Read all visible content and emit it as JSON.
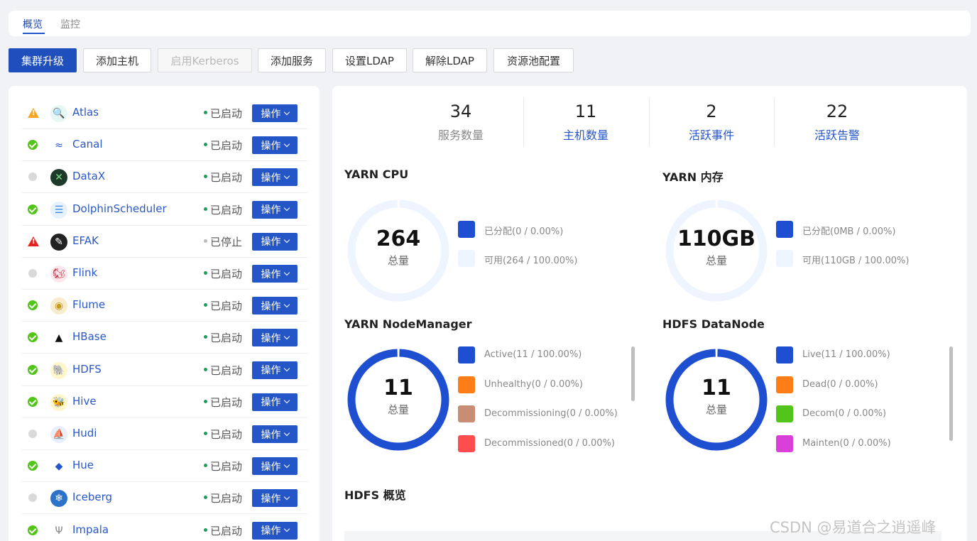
{
  "tabs": [
    {
      "label": "概览",
      "active": true
    },
    {
      "label": "监控",
      "active": false
    }
  ],
  "toolbar": {
    "upgrade": "集群升级",
    "add_host": "添加主机",
    "enable_kerberos": "启用Kerberos",
    "add_service": "添加服务",
    "set_ldap": "设置LDAP",
    "remove_ldap": "解除LDAP",
    "resource_pool": "资源池配置"
  },
  "operate_label": "操作",
  "services": [
    {
      "name": "Atlas",
      "health": "warning",
      "state": "已启动",
      "logo": "atlas-icon"
    },
    {
      "name": "Canal",
      "health": "ok",
      "state": "已启动",
      "logo": "canal-icon"
    },
    {
      "name": "DataX",
      "health": "unknown",
      "state": "已启动",
      "logo": "datax-icon"
    },
    {
      "name": "DolphinScheduler",
      "health": "ok",
      "state": "已启动",
      "logo": "dolphinscheduler-icon"
    },
    {
      "name": "EFAK",
      "health": "error",
      "state": "已停止",
      "logo": "efak-icon"
    },
    {
      "name": "Flink",
      "health": "unknown",
      "state": "已启动",
      "logo": "flink-icon"
    },
    {
      "name": "Flume",
      "health": "ok",
      "state": "已启动",
      "logo": "flume-icon"
    },
    {
      "name": "HBase",
      "health": "ok",
      "state": "已启动",
      "logo": "hbase-icon"
    },
    {
      "name": "HDFS",
      "health": "ok",
      "state": "已启动",
      "logo": "hdfs-icon"
    },
    {
      "name": "Hive",
      "health": "ok",
      "state": "已启动",
      "logo": "hive-icon"
    },
    {
      "name": "Hudi",
      "health": "unknown",
      "state": "已启动",
      "logo": "hudi-icon"
    },
    {
      "name": "Hue",
      "health": "ok",
      "state": "已启动",
      "logo": "hue-icon"
    },
    {
      "name": "Iceberg",
      "health": "unknown",
      "state": "已启动",
      "logo": "iceberg-icon"
    },
    {
      "name": "Impala",
      "health": "ok",
      "state": "已启动",
      "logo": "impala-icon"
    }
  ],
  "stats": [
    {
      "value": "34",
      "label": "服务数量",
      "link": false
    },
    {
      "value": "11",
      "label": "主机数量",
      "link": true
    },
    {
      "value": "2",
      "label": "活跃事件",
      "link": true
    },
    {
      "value": "22",
      "label": "活跃告警",
      "link": true
    }
  ],
  "widgets": {
    "yarn_cpu": {
      "title": "YARN CPU",
      "total": "264",
      "total_label": "总量",
      "legend": [
        {
          "label": "已分配(0 / 0.00%)",
          "color": "#1f4fd1",
          "fraction": 0
        },
        {
          "label": "可用(264 / 100.00%)",
          "color": "#eef5fe",
          "fraction": 1
        }
      ]
    },
    "yarn_mem": {
      "title": "YARN 内存",
      "total": "110GB",
      "total_label": "总量",
      "legend": [
        {
          "label": "已分配(0MB / 0.00%)",
          "color": "#1f4fd1",
          "fraction": 0
        },
        {
          "label": "可用(110GB / 100.00%)",
          "color": "#eef5fe",
          "fraction": 1
        }
      ]
    },
    "yarn_nm": {
      "title": "YARN NodeManager",
      "total": "11",
      "total_label": "总量",
      "legend": [
        {
          "label": "Active(11 / 100.00%)",
          "color": "#1f4fd1",
          "fraction": 1
        },
        {
          "label": "Unhealthy(0 / 0.00%)",
          "color": "#ff7d17",
          "fraction": 0
        },
        {
          "label": "Decommissioning(0 / 0.00%)",
          "color": "#c98c74",
          "fraction": 0
        },
        {
          "label": "Decommissioned(0 / 0.00%)",
          "color": "#ff4d4f",
          "fraction": 0
        }
      ]
    },
    "hdfs_dn": {
      "title": "HDFS DataNode",
      "total": "11",
      "total_label": "总量",
      "legend": [
        {
          "label": "Live(11 / 100.00%)",
          "color": "#1f4fd1",
          "fraction": 1
        },
        {
          "label": "Dead(0 / 0.00%)",
          "color": "#ff7d17",
          "fraction": 0
        },
        {
          "label": "Decom(0 / 0.00%)",
          "color": "#52c41a",
          "fraction": 0
        },
        {
          "label": "Mainten(0 / 0.00%)",
          "color": "#d93fd9",
          "fraction": 0
        }
      ]
    }
  },
  "hdfs_overview_title": "HDFS 概览",
  "watermark": "CSDN @易道合之逍遥峰"
}
